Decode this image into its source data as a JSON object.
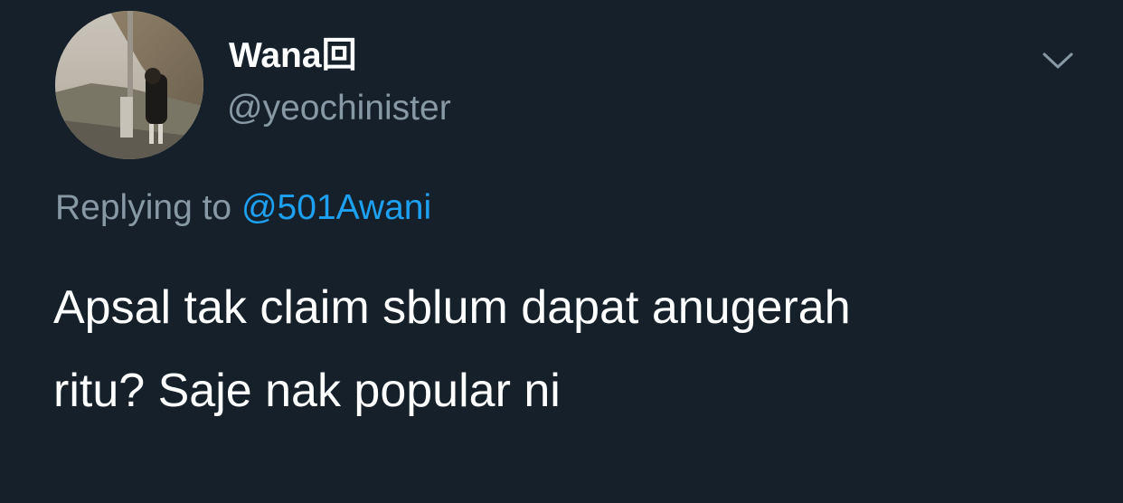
{
  "tweet": {
    "display_name": "Wana回",
    "handle": "@yeochinister",
    "reply_prefix": "Replying to",
    "reply_target": "@501Awani",
    "text_line1": "Apsal tak claim sblum dapat anugerah",
    "text_line2": "ritu? Saje nak popular ni"
  },
  "icons": {
    "avatar": "profile-photo",
    "menu": "chevron-down-icon"
  },
  "colors": {
    "background": "#15202b",
    "primary_text": "#ffffff",
    "secondary_text": "#8899a6",
    "link": "#1da1f2"
  }
}
